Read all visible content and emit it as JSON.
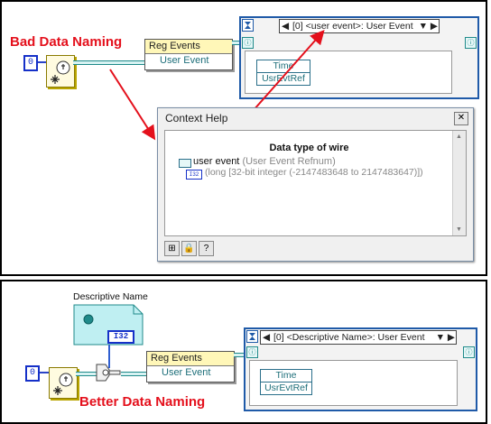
{
  "top": {
    "heading": "Bad Data Naming",
    "constant_value": "0",
    "reg_events": {
      "title": "Reg Events",
      "row": "User Event"
    },
    "event_structure": {
      "selector": "[0] <user event>: User Event",
      "data_node_rows": [
        "Time",
        "UsrEvtRef"
      ]
    },
    "context_help": {
      "title": "Context Help",
      "close_glyph": "✕",
      "heading": "Data type of wire",
      "name_strong": "user event",
      "name_type": "(User Event Refnum)",
      "element_type": "(long [32-bit integer (-2147483648 to 2147483647)])",
      "type_badge": "I32",
      "toolbar_glyphs": [
        "⊞",
        "🔒",
        "?"
      ]
    }
  },
  "bottom": {
    "constant_label": "Descriptive Name",
    "constant_value": "0",
    "constant_badge": "I32",
    "heading": "Better Data Naming",
    "reg_events": {
      "title": "Reg Events",
      "row": "User Event"
    },
    "event_structure": {
      "selector": "[0] <Descriptive Name>: User Event",
      "data_node_rows": [
        "Time",
        "UsrEvtRef"
      ]
    }
  },
  "colors": {
    "accent_red": "#e4101c",
    "wire_blue": "#2a44c8",
    "event_teal": "#1e6f7a"
  }
}
